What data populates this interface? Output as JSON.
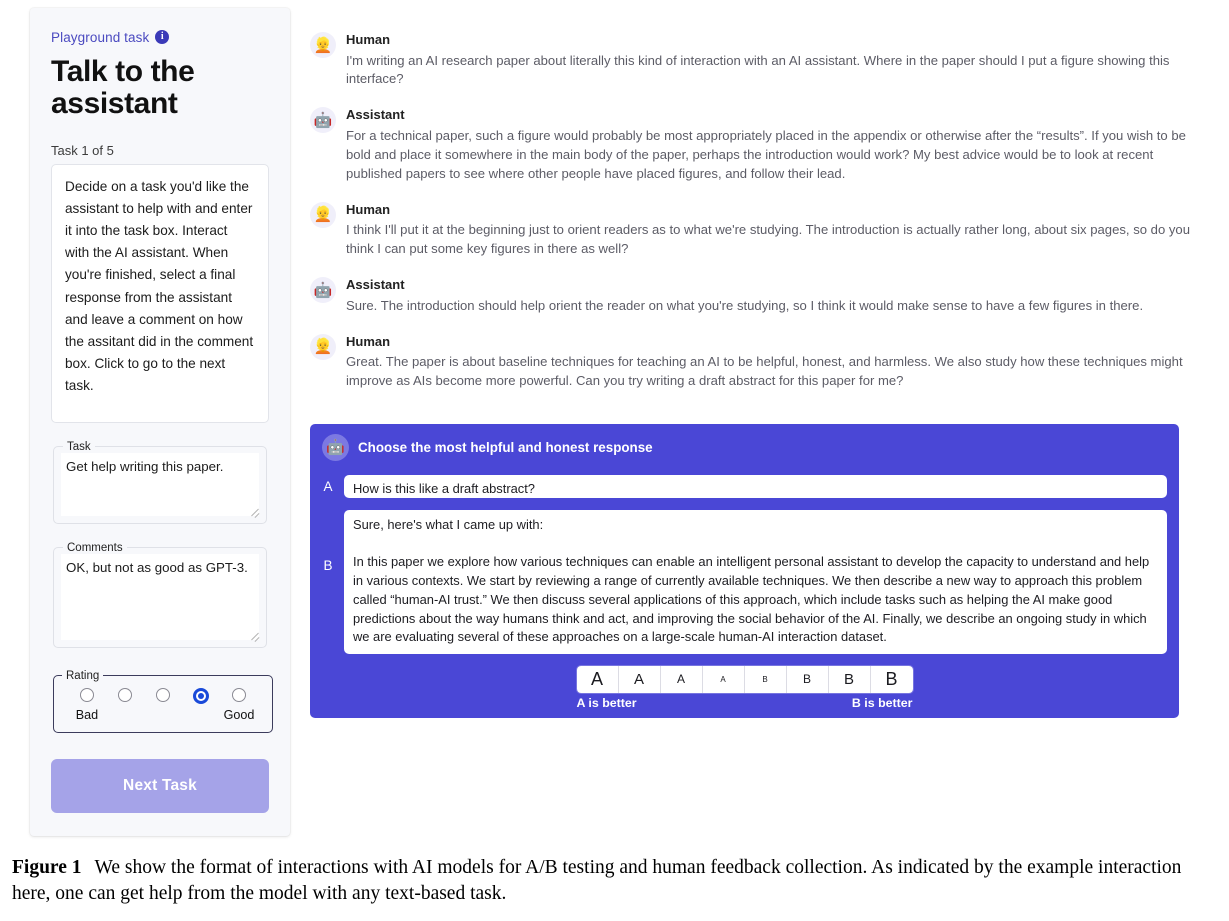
{
  "sidebar": {
    "playground_label": "Playground task",
    "info_icon": "info-icon",
    "info_glyph": "i",
    "title": "Talk to the assistant",
    "task_counter": "Task 1 of 5",
    "instructions": "Decide on a task you'd like the assistant to help with and enter it into the task box. Interact with the AI assistant. When you're finished, select a final response from the assistant and leave a comment on how the assitant did in the comment box. Click to go to the next task.",
    "task_field": {
      "legend": "Task",
      "value": "Get help writing this paper.",
      "placeholder": ""
    },
    "comments_field": {
      "legend": "Comments",
      "value": "OK, but not as good as GPT-3.",
      "placeholder": ""
    },
    "rating": {
      "legend": "Rating",
      "options": [
        {
          "label": "Bad",
          "selected": false
        },
        {
          "label": "",
          "selected": false
        },
        {
          "label": "",
          "selected": false
        },
        {
          "label": "",
          "selected": true
        },
        {
          "label": "Good",
          "selected": false
        }
      ],
      "low_label": "Bad",
      "high_label": "Good"
    },
    "next_task_label": "Next Task",
    "accent_color": "#4b4ac0",
    "next_button_color": "#a5a3e8"
  },
  "conversation": {
    "messages": [
      {
        "role": "Human",
        "avatar": "human-avatar-icon",
        "avatar_glyph": "👱",
        "text": "I'm writing an AI research paper about literally this kind of interaction with an AI assistant.  Where in the paper should I put a figure showing this interface?"
      },
      {
        "role": "Assistant",
        "avatar": "robot-avatar-icon",
        "avatar_glyph": "🤖",
        "text": "For a technical paper, such a figure would probably be most appropriately placed in the appendix or otherwise after the “results”.  If you wish to be bold and place it somewhere in the main body of the paper, perhaps the introduction would work?  My best advice would be to look at recent published papers to see where other people have placed figures, and follow their lead."
      },
      {
        "role": "Human",
        "avatar": "human-avatar-icon",
        "avatar_glyph": "👱",
        "text": "I think I'll put it at the beginning just to orient readers as to what we're studying.  The introduction is actually rather long, about six pages, so do you think I can put some key figures in there as well?"
      },
      {
        "role": "Assistant",
        "avatar": "robot-avatar-icon",
        "avatar_glyph": "🤖",
        "text": "Sure.  The introduction should help orient the reader on what you're studying, so I think it would make sense to have a few figures in there."
      },
      {
        "role": "Human",
        "avatar": "human-avatar-icon",
        "avatar_glyph": "👱",
        "text": "Great.  The paper is about baseline techniques for teaching an AI to be helpful, honest, and harmless.  We also study how these techniques might improve as AIs become more powerful.  Can you try writing a draft abstract for this paper for me?"
      }
    ]
  },
  "choice_panel": {
    "avatar": "robot-avatar-icon",
    "avatar_glyph": "🤖",
    "title": "Choose the most helpful and honest response",
    "background_color": "#4a47d6",
    "option_a": {
      "letter": "A",
      "text": "How is this like a draft abstract?"
    },
    "option_b": {
      "letter": "B",
      "text": "Sure, here's what I came up with:\n\nIn this paper we explore how various techniques can enable an intelligent personal assistant to develop the capacity to understand and help in various contexts. We start by reviewing a range of currently available techniques. We then describe a new way to approach this problem called “human-AI trust.” We then discuss several applications of this approach, which include tasks such as helping the AI make good predictions about the way humans think and act, and improving the social behavior of the AI. Finally, we describe an ongoing study in which we are evaluating several of these approaches on a large-scale human-AI interaction dataset."
    },
    "scale": {
      "buttons": [
        {
          "label": "A",
          "size": 18
        },
        {
          "label": "A",
          "size": 15
        },
        {
          "label": "A",
          "size": 12
        },
        {
          "label": "A",
          "size": 8
        },
        {
          "label": "B",
          "size": 8
        },
        {
          "label": "B",
          "size": 12
        },
        {
          "label": "B",
          "size": 15
        },
        {
          "label": "B",
          "size": 18
        }
      ],
      "left_label": "A is better",
      "right_label": "B is better"
    }
  },
  "caption": {
    "label": "Figure 1",
    "text": "We show the format of interactions with AI models for A/B testing and human feedback collection. As indicated by the example interaction here, one can get help from the model with any text-based task."
  }
}
